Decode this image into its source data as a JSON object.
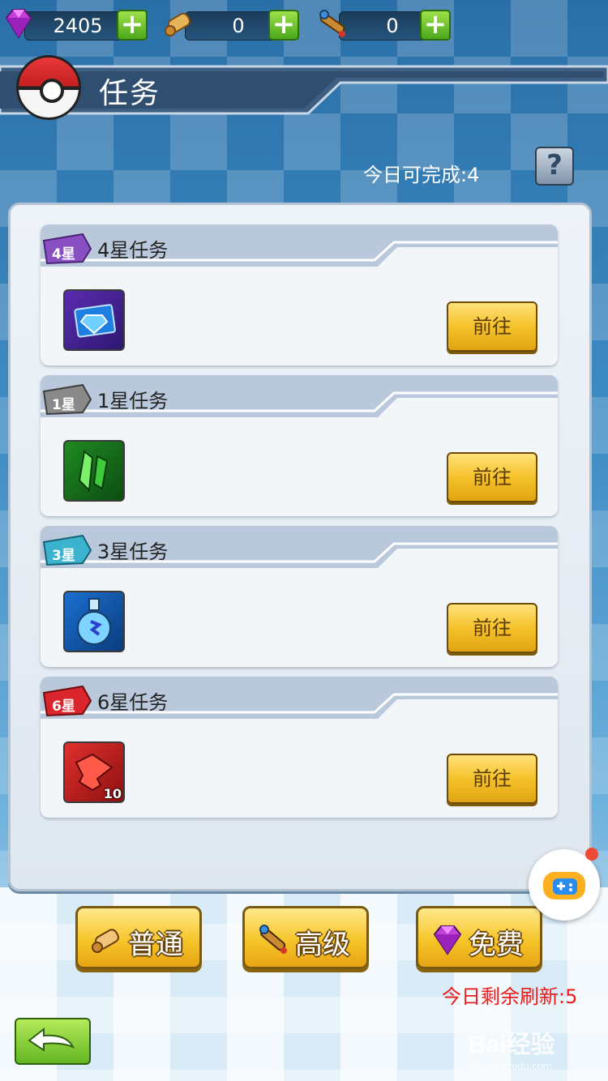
{
  "resources": {
    "gems": "2405",
    "scrolls": "0",
    "telescopes": "0"
  },
  "header": {
    "title": "任务"
  },
  "today_completable": "今日可完成:4",
  "help_label": "?",
  "tasks": [
    {
      "badge": "4星",
      "name": "4星任务",
      "reward_icon": "gem-card-icon",
      "go_label": "前往",
      "color": "#8b4fc4"
    },
    {
      "badge": "1星",
      "name": "1星任务",
      "reward_icon": "green-crystal-icon",
      "go_label": "前往",
      "color": "#8a8a8a"
    },
    {
      "badge": "3星",
      "name": "3星任务",
      "reward_icon": "potion-bottle-icon",
      "go_label": "前往",
      "color": "#3bb3cf"
    },
    {
      "badge": "6星",
      "name": "6星任务",
      "reward_icon": "red-puzzle-icon",
      "reward_qty": "10",
      "go_label": "前往",
      "color": "#d9252b"
    }
  ],
  "bottom_buttons": [
    {
      "label": "普通",
      "icon": "scroll-icon"
    },
    {
      "label": "高级",
      "icon": "telescope-icon"
    },
    {
      "label": "免费",
      "icon": "gem-icon"
    }
  ],
  "refresh_text": "今日剩余刷新:5",
  "watermark": {
    "main": "Bai经验",
    "sub": "jingyan.baidu.com"
  }
}
